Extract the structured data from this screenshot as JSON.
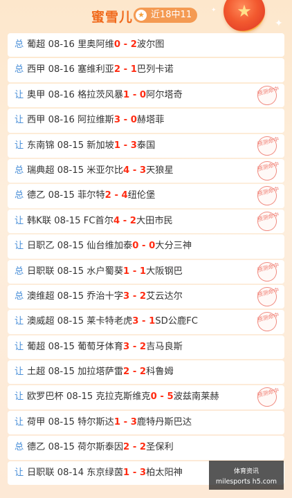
{
  "header": {
    "title": "蜜雪儿",
    "badge": "近18中11",
    "badge_icon": "star-icon",
    "medal_icon": "medal-star-icon"
  },
  "stamp_text": "预测命中",
  "matches": [
    {
      "tag": "总",
      "league": "葡超",
      "date": "08-16",
      "home": "里奥阿维",
      "home_score": "0",
      "away_score": "2",
      "away": "波尔图",
      "hit": false
    },
    {
      "tag": "总",
      "league": "西甲",
      "date": "08-16",
      "home": "塞维利亚",
      "home_score": "2",
      "away_score": "1",
      "away": "巴列卡诺",
      "hit": false
    },
    {
      "tag": "让",
      "league": "奥甲",
      "date": "08-16",
      "home": "格拉茨风暴",
      "home_score": "1",
      "away_score": "0",
      "away": "阿尔塔奇",
      "hit": true
    },
    {
      "tag": "让",
      "league": "西甲",
      "date": "08-16",
      "home": "阿拉维斯",
      "home_score": "3",
      "away_score": "0",
      "away": "赫塔菲",
      "hit": false
    },
    {
      "tag": "让",
      "league": "东南锦",
      "date": "08-15",
      "home": "新加坡",
      "home_score": "1",
      "away_score": "3",
      "away": "泰国",
      "hit": true
    },
    {
      "tag": "总",
      "league": "瑞典超",
      "date": "08-15",
      "home": "米亚尔比",
      "home_score": "4",
      "away_score": "3",
      "away": "天狼星",
      "hit": true
    },
    {
      "tag": "总",
      "league": "德乙",
      "date": "08-15",
      "home": "菲尔特",
      "home_score": "2",
      "away_score": "4",
      "away": "纽伦堡",
      "hit": true
    },
    {
      "tag": "让",
      "league": "韩K联",
      "date": "08-15",
      "home": "FC首尔",
      "home_score": "4",
      "away_score": "2",
      "away": "大田市民",
      "hit": true
    },
    {
      "tag": "让",
      "league": "日职乙",
      "date": "08-15",
      "home": "仙台维加泰",
      "home_score": "0",
      "away_score": "0",
      "away": "大分三神",
      "hit": false
    },
    {
      "tag": "总",
      "league": "日职联",
      "date": "08-15",
      "home": "水户蜀葵",
      "home_score": "1",
      "away_score": "1",
      "away": "大阪钢巴",
      "hit": true
    },
    {
      "tag": "总",
      "league": "澳维超",
      "date": "08-15",
      "home": "乔治十字",
      "home_score": "3",
      "away_score": "2",
      "away": "艾云达尔",
      "hit": true
    },
    {
      "tag": "让",
      "league": "澳威超",
      "date": "08-15",
      "home": "莱卡特老虎",
      "home_score": "3",
      "away_score": "1",
      "away": "SD公鹿FC",
      "hit": true
    },
    {
      "tag": "让",
      "league": "葡超",
      "date": "08-15",
      "home": "葡萄牙体育",
      "home_score": "3",
      "away_score": "2",
      "away": "吉马良斯",
      "hit": false
    },
    {
      "tag": "让",
      "league": "土超",
      "date": "08-15",
      "home": "加拉塔萨雷",
      "home_score": "2",
      "away_score": "2",
      "away": "科鲁姆",
      "hit": false
    },
    {
      "tag": "让",
      "league": "欧罗巴杯",
      "date": "08-15",
      "home": "克拉克斯维克",
      "home_score": "0",
      "away_score": "5",
      "away": "波兹南莱赫",
      "hit": true
    },
    {
      "tag": "让",
      "league": "荷甲",
      "date": "08-15",
      "home": "特尔斯达",
      "home_score": "1",
      "away_score": "3",
      "away": "鹿特丹斯巴达",
      "hit": false
    },
    {
      "tag": "总",
      "league": "德乙",
      "date": "08-15",
      "home": "荷尔斯泰因",
      "home_score": "2",
      "away_score": "2",
      "away": "圣保利",
      "hit": false
    },
    {
      "tag": "让",
      "league": "日职联",
      "date": "08-14",
      "home": "东京绿茵",
      "home_score": "1",
      "away_score": "3",
      "away": "柏太阳神",
      "hit": false
    }
  ],
  "watermark": {
    "line1": "体育资讯",
    "line2": "milesports h5.com"
  }
}
